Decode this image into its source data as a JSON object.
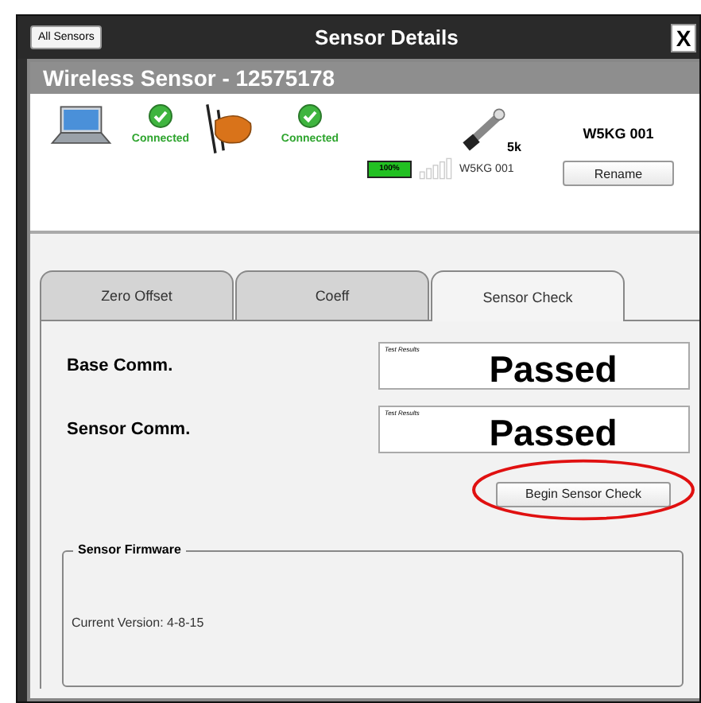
{
  "window": {
    "title": "Sensor Details",
    "back_button": "All Sensors",
    "close_button": "X"
  },
  "header": {
    "title": "Wireless Sensor - 12575178"
  },
  "status": {
    "links": [
      {
        "label": "Connected",
        "connected": true
      },
      {
        "label": "Connected",
        "connected": true
      }
    ],
    "sensor_capacity": "5k",
    "battery": {
      "label": "100%",
      "level": 1.0
    },
    "sensor_name": "W5KG 001",
    "device_name": "W5KG 001",
    "rename_button": "Rename"
  },
  "tabs": [
    {
      "label": "Zero Offset",
      "selected": false
    },
    {
      "label": "Coeff",
      "selected": false
    },
    {
      "label": "Sensor Check",
      "selected": true
    }
  ],
  "checks": [
    {
      "label": "Base Comm.",
      "caption": "Test Results",
      "result": "Passed"
    },
    {
      "label": "Sensor Comm.",
      "caption": "Test Results",
      "result": "Passed"
    }
  ],
  "begin_button": {
    "label": "Begin Sensor Check",
    "highlighted": true
  },
  "firmware": {
    "title": "Sensor Firmware",
    "version": "Current Version: 4-8-15"
  }
}
